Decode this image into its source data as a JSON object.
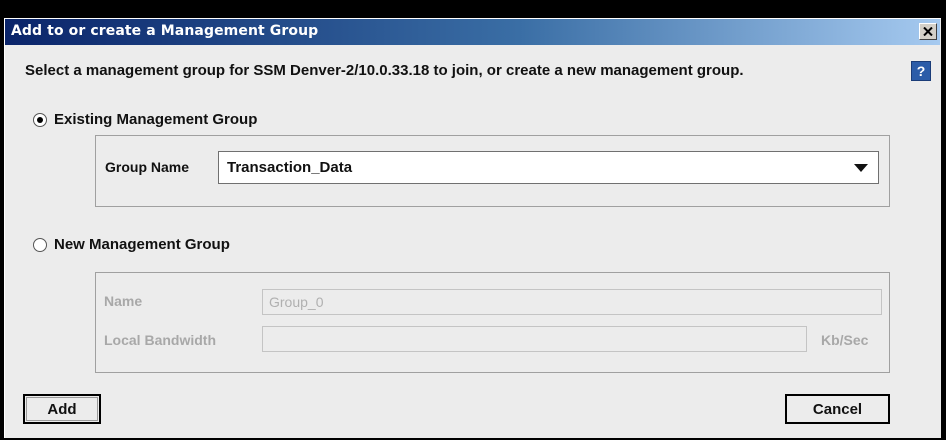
{
  "window": {
    "title": "Add to or create a Management Group",
    "close_icon": "close-icon"
  },
  "prompt": {
    "text": "Select a management group for SSM Denver-2/10.0.33.18 to join, or create a new management group.",
    "help_label": "?"
  },
  "existing_group": {
    "radio_label": "Existing Management Group",
    "selected": true,
    "group_name_label": "Group Name",
    "group_name_value": "Transaction_Data"
  },
  "new_group": {
    "radio_label": "New Management Group",
    "selected": false,
    "name_label": "Name",
    "name_placeholder": "Group_0",
    "bandwidth_label": "Local Bandwidth",
    "bandwidth_value": "",
    "bandwidth_unit": "Kb/Sec"
  },
  "buttons": {
    "add_label": "Add",
    "cancel_label": "Cancel"
  },
  "colors": {
    "titlebar_start": "#0a246a",
    "titlebar_end": "#a6caf0",
    "dialog_bg": "#ececec",
    "help_bg": "#2b5ca8"
  }
}
